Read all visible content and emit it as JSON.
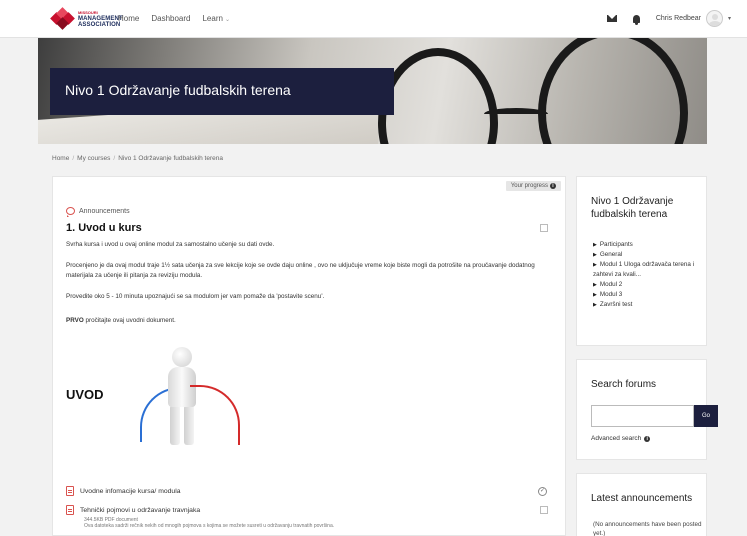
{
  "navbar": {
    "logo_small": "MISSOURI",
    "logo_line1": "MANAGEMENT",
    "logo_line2": "ASSOCIATION",
    "links": [
      "Home",
      "Dashboard",
      "Learn"
    ],
    "user_name": "Chris Redbear"
  },
  "hero": {
    "title": "Nivo 1 Održavanje fudbalskih terena"
  },
  "breadcrumb": [
    "Home",
    "My courses",
    "Nivo 1 Održavanje fudbalskih terena"
  ],
  "main": {
    "progress_label": "Your progress",
    "announcements_label": "Announcements",
    "section_title": "1. Uvod u kurs",
    "paragraphs": [
      "Svrha kursa i uvod u ovaj online modul za samostalno učenje su dati ovde.",
      "Procenjeno je da ovaj modul traje 1½ sata učenja za sve lekcije koje se ovde daju online , ovo ne uključuje vreme koje biste mogli da potrošite na proučavanje dodatnog materijala za učenje ili pitanja za reviziju  modula.",
      "Provedite oko 5 - 10 minuta upoznajući se sa modulom jer vam pomaže da 'postavite scenu'."
    ],
    "first_bold": "PRVO",
    "first_rest": " pročitajte ovaj uvodni dokument.",
    "image_label": "UVOD",
    "files": [
      {
        "name": "Uvodne infomacije kursa/ modula"
      },
      {
        "name": "Tehnički pojmovi u održavanje travnjaka"
      }
    ],
    "file_meta_size": "344.5KB PDF document",
    "file_meta_desc": "Ova datoteka sadrži rečnik  nekih od mnogih pojmova s kojima se možete susreti u održavanju travnatih površina."
  },
  "sidebar": {
    "course_block": {
      "title": "Nivo 1 Održavanje fudbalskih terena",
      "items": [
        "Participants",
        "General",
        "Modul 1 Uloga održavača terena i zahtevi za kvali...",
        "Modul 2",
        "Modul 3",
        "Završni test"
      ]
    },
    "search_block": {
      "title": "Search forums",
      "go_label": "Go",
      "advanced_label": "Advanced search"
    },
    "news_block": {
      "title": "Latest announcements",
      "note": "(No announcements have been posted yet.)"
    }
  }
}
